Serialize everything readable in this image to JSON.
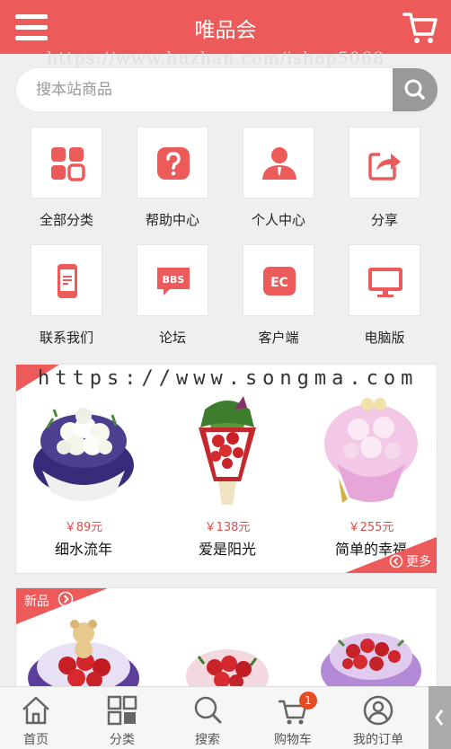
{
  "header": {
    "title": "唯品会"
  },
  "watermark_top": "https://www.huzhan.com/ishop5068",
  "search": {
    "placeholder": "搜本站商品"
  },
  "nav": [
    {
      "label": "全部分类",
      "icon": "grid-icon"
    },
    {
      "label": "帮助中心",
      "icon": "question-icon"
    },
    {
      "label": "个人中心",
      "icon": "user-icon"
    },
    {
      "label": "分享",
      "icon": "share-icon"
    },
    {
      "label": "联系我们",
      "icon": "phone-icon"
    },
    {
      "label": "论坛",
      "icon": "bbs-icon"
    },
    {
      "label": "客户端",
      "icon": "ec-icon"
    },
    {
      "label": "电脑版",
      "icon": "monitor-icon"
    }
  ],
  "nav_icon_text": {
    "bbs": "BBS",
    "ec": "EC"
  },
  "watermark_panel": "https://www.songma.com",
  "products": [
    {
      "price": "￥89元",
      "name": "细水流年"
    },
    {
      "price": "￥138元",
      "name": "爱是阳光"
    },
    {
      "price": "￥255元",
      "name": "简单的幸福"
    }
  ],
  "more_label": "更多",
  "new_label": "新品",
  "tabs": [
    {
      "label": "首页",
      "icon": "home-icon"
    },
    {
      "label": "分类",
      "icon": "category-icon"
    },
    {
      "label": "搜索",
      "icon": "search-icon"
    },
    {
      "label": "购物车",
      "icon": "cart-icon",
      "badge": "1"
    },
    {
      "label": "我的订单",
      "icon": "user-circle-icon"
    }
  ],
  "colors": {
    "accent": "#ec5a5a",
    "price": "#e04a4a",
    "badge": "#e54c24"
  }
}
